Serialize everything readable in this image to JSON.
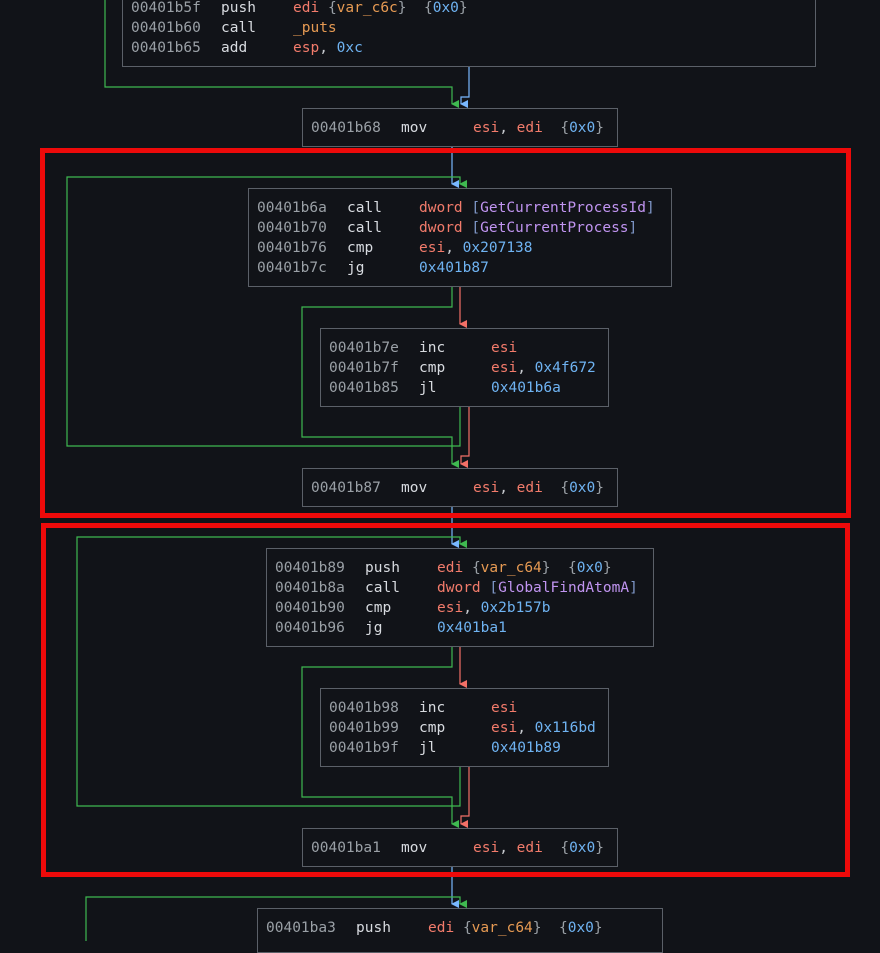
{
  "colors": {
    "background": "#111318",
    "block_border": "#5b6068",
    "edge_true": "#3fb950",
    "edge_false": "#f47067",
    "edge_unconditional": "#79b8ff",
    "highlight": "#ee0a0a"
  },
  "blocks": [
    {
      "lines": [
        {
          "addr": "00401b5f",
          "mnemonic": "push",
          "ops": [
            [
              "reg",
              "edi"
            ],
            [
              "txt",
              " "
            ],
            [
              "brace",
              "{"
            ],
            [
              "sym",
              "var_c6c"
            ],
            [
              "brace",
              "}"
            ],
            [
              "txt",
              "  "
            ],
            [
              "brace",
              "{"
            ],
            [
              "imm",
              "0x0"
            ],
            [
              "brace",
              "}"
            ]
          ]
        },
        {
          "addr": "00401b60",
          "mnemonic": "call",
          "ops": [
            [
              "sym",
              "_puts"
            ]
          ]
        },
        {
          "addr": "00401b65",
          "mnemonic": "add",
          "ops": [
            [
              "reg",
              "esp"
            ],
            [
              "txt",
              ", "
            ],
            [
              "imm",
              "0xc"
            ]
          ]
        }
      ]
    },
    {
      "lines": [
        {
          "addr": "00401b68",
          "mnemonic": "mov",
          "ops": [
            [
              "reg",
              "esi"
            ],
            [
              "txt",
              ", "
            ],
            [
              "reg",
              "edi"
            ],
            [
              "txt",
              "  "
            ],
            [
              "brace",
              "{"
            ],
            [
              "imm",
              "0x0"
            ],
            [
              "brace",
              "}"
            ]
          ]
        }
      ]
    },
    {
      "lines": [
        {
          "addr": "00401b6a",
          "mnemonic": "call",
          "ops": [
            [
              "reg",
              "dword"
            ],
            [
              "txt",
              " "
            ],
            [
              "brk",
              "["
            ],
            [
              "api",
              "GetCurrentProcessId"
            ],
            [
              "brk",
              "]"
            ]
          ]
        },
        {
          "addr": "00401b70",
          "mnemonic": "call",
          "ops": [
            [
              "reg",
              "dword"
            ],
            [
              "txt",
              " "
            ],
            [
              "brk",
              "["
            ],
            [
              "api",
              "GetCurrentProcess"
            ],
            [
              "brk",
              "]"
            ]
          ]
        },
        {
          "addr": "00401b76",
          "mnemonic": "cmp",
          "ops": [
            [
              "reg",
              "esi"
            ],
            [
              "txt",
              ", "
            ],
            [
              "imm",
              "0x207138"
            ]
          ]
        },
        {
          "addr": "00401b7c",
          "mnemonic": "jg",
          "ops": [
            [
              "imm",
              "0x401b87"
            ]
          ]
        }
      ]
    },
    {
      "lines": [
        {
          "addr": "00401b7e",
          "mnemonic": "inc",
          "ops": [
            [
              "reg",
              "esi"
            ]
          ]
        },
        {
          "addr": "00401b7f",
          "mnemonic": "cmp",
          "ops": [
            [
              "reg",
              "esi"
            ],
            [
              "txt",
              ", "
            ],
            [
              "imm",
              "0x4f672"
            ]
          ]
        },
        {
          "addr": "00401b85",
          "mnemonic": "jl",
          "ops": [
            [
              "imm",
              "0x401b6a"
            ]
          ]
        }
      ]
    },
    {
      "lines": [
        {
          "addr": "00401b87",
          "mnemonic": "mov",
          "ops": [
            [
              "reg",
              "esi"
            ],
            [
              "txt",
              ", "
            ],
            [
              "reg",
              "edi"
            ],
            [
              "txt",
              "  "
            ],
            [
              "brace",
              "{"
            ],
            [
              "imm",
              "0x0"
            ],
            [
              "brace",
              "}"
            ]
          ]
        }
      ]
    },
    {
      "lines": [
        {
          "addr": "00401b89",
          "mnemonic": "push",
          "ops": [
            [
              "reg",
              "edi"
            ],
            [
              "txt",
              " "
            ],
            [
              "brace",
              "{"
            ],
            [
              "sym",
              "var_c64"
            ],
            [
              "brace",
              "}"
            ],
            [
              "txt",
              "  "
            ],
            [
              "brace",
              "{"
            ],
            [
              "imm",
              "0x0"
            ],
            [
              "brace",
              "}"
            ]
          ]
        },
        {
          "addr": "00401b8a",
          "mnemonic": "call",
          "ops": [
            [
              "reg",
              "dword"
            ],
            [
              "txt",
              " "
            ],
            [
              "brk",
              "["
            ],
            [
              "api",
              "GlobalFindAtomA"
            ],
            [
              "brk",
              "]"
            ]
          ]
        },
        {
          "addr": "00401b90",
          "mnemonic": "cmp",
          "ops": [
            [
              "reg",
              "esi"
            ],
            [
              "txt",
              ", "
            ],
            [
              "imm",
              "0x2b157b"
            ]
          ]
        },
        {
          "addr": "00401b96",
          "mnemonic": "jg",
          "ops": [
            [
              "imm",
              "0x401ba1"
            ]
          ]
        }
      ]
    },
    {
      "lines": [
        {
          "addr": "00401b98",
          "mnemonic": "inc",
          "ops": [
            [
              "reg",
              "esi"
            ]
          ]
        },
        {
          "addr": "00401b99",
          "mnemonic": "cmp",
          "ops": [
            [
              "reg",
              "esi"
            ],
            [
              "txt",
              ", "
            ],
            [
              "imm",
              "0x116bd"
            ]
          ]
        },
        {
          "addr": "00401b9f",
          "mnemonic": "jl",
          "ops": [
            [
              "imm",
              "0x401b89"
            ]
          ]
        }
      ]
    },
    {
      "lines": [
        {
          "addr": "00401ba1",
          "mnemonic": "mov",
          "ops": [
            [
              "reg",
              "esi"
            ],
            [
              "txt",
              ", "
            ],
            [
              "reg",
              "edi"
            ],
            [
              "txt",
              "  "
            ],
            [
              "brace",
              "{"
            ],
            [
              "imm",
              "0x0"
            ],
            [
              "brace",
              "}"
            ]
          ]
        }
      ]
    },
    {
      "lines": [
        {
          "addr": "00401ba3",
          "mnemonic": "push",
          "ops": [
            [
              "reg",
              "edi"
            ],
            [
              "txt",
              " "
            ],
            [
              "brace",
              "{"
            ],
            [
              "sym",
              "var_c64"
            ],
            [
              "brace",
              "}"
            ],
            [
              "txt",
              "  "
            ],
            [
              "brace",
              "{"
            ],
            [
              "imm",
              "0x0"
            ],
            [
              "brace",
              "}"
            ]
          ]
        }
      ]
    }
  ]
}
